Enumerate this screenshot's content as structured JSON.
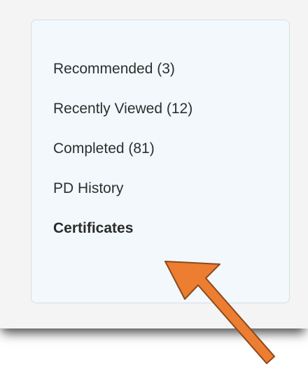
{
  "menu": {
    "items": [
      {
        "label": "Recommended (3)",
        "active": false
      },
      {
        "label": "Recently Viewed (12)",
        "active": false
      },
      {
        "label": "Completed (81)",
        "active": false
      },
      {
        "label": "PD History",
        "active": false
      },
      {
        "label": "Certificates",
        "active": true
      }
    ]
  },
  "colors": {
    "panel_background": "#f2f8fc",
    "text": "#2e2e2e",
    "arrow_fill": "#ed7d31",
    "arrow_stroke": "#8b4a1c"
  }
}
